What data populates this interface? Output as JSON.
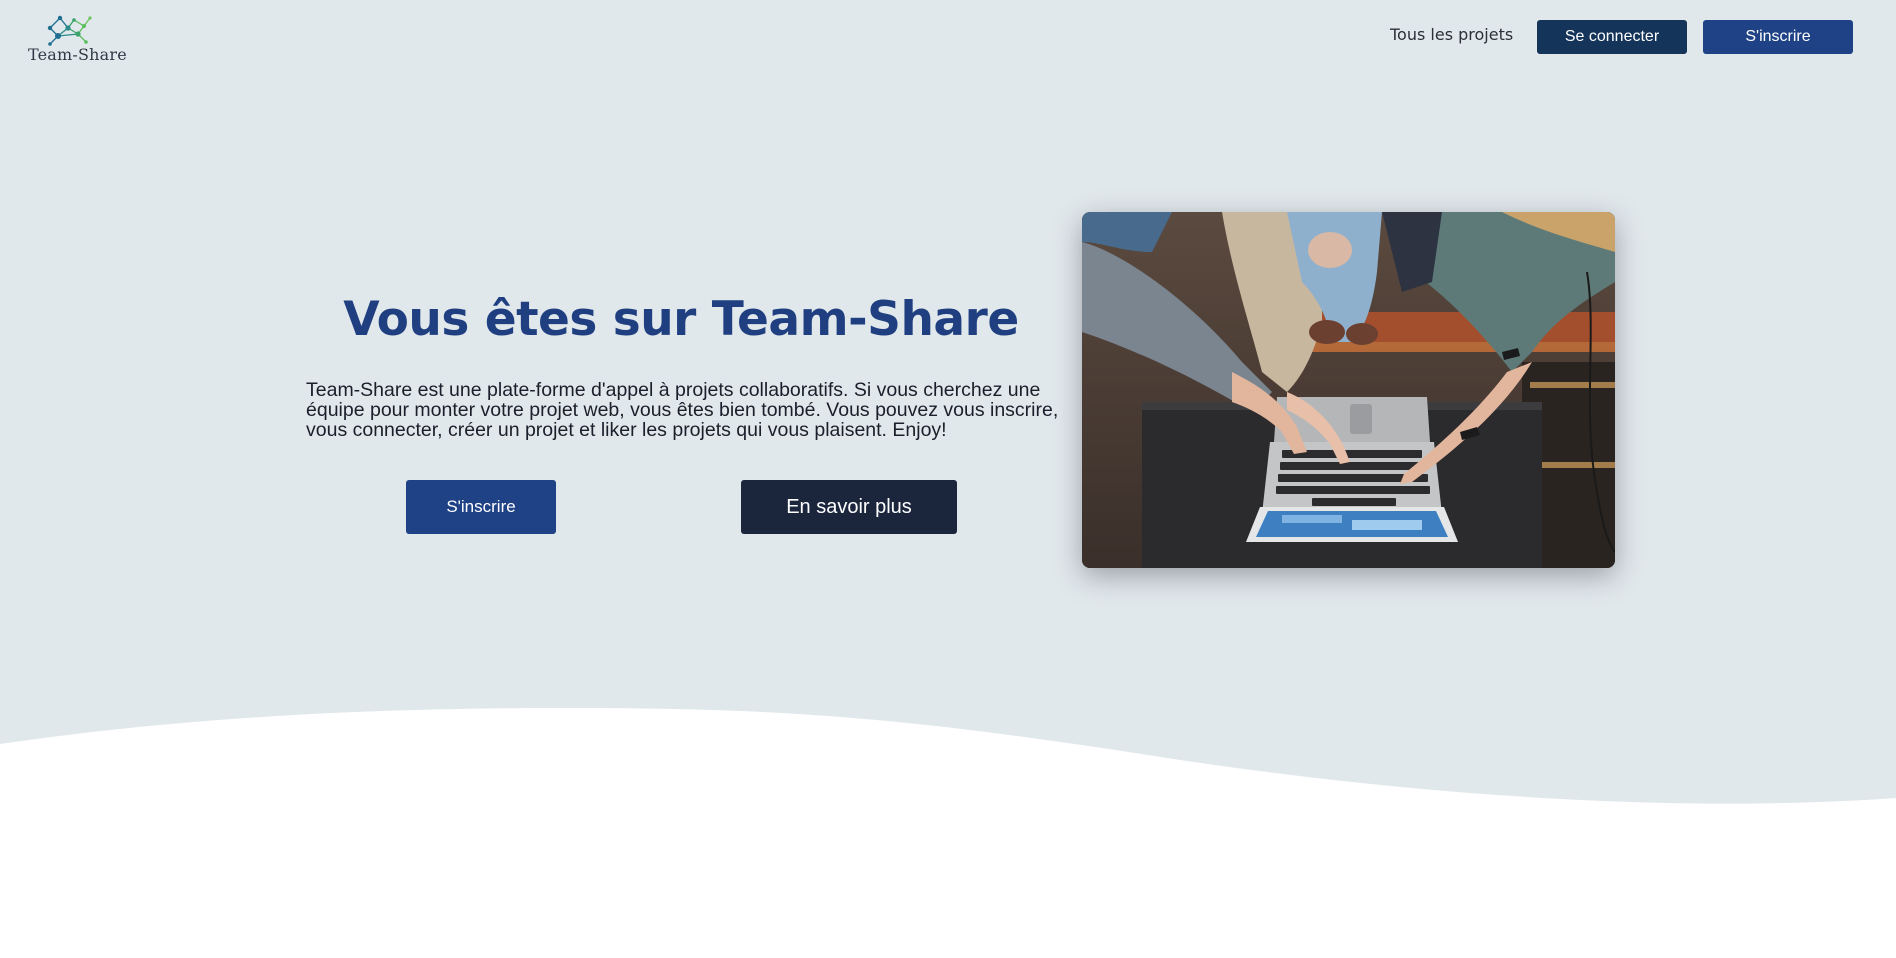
{
  "brand": {
    "name": "Team-Share"
  },
  "nav": {
    "all_projects": "Tous les projets",
    "login": "Se connecter",
    "signup": "S'inscrire"
  },
  "hero": {
    "title": "Vous êtes sur Team-Share",
    "description": "Team-Share est une plate-forme d'appel à projets collaboratifs. Si vous cherchez une équipe pour monter votre projet web, vous êtes bien tombé. Vous pouvez vous inscrire, vous connecter, créer un projet et liker les projets qui vous plaisent. Enjoy!",
    "signup_button": "S'inscrire",
    "more_button": "En savoir plus",
    "image": "photo-hands-pointing-at-laptop"
  },
  "colors": {
    "hero_background": "#e1e8ec",
    "primary": "#1f4185",
    "login_button": "#15345a",
    "dark_button": "#1b263d",
    "title": "#1f3f80"
  }
}
